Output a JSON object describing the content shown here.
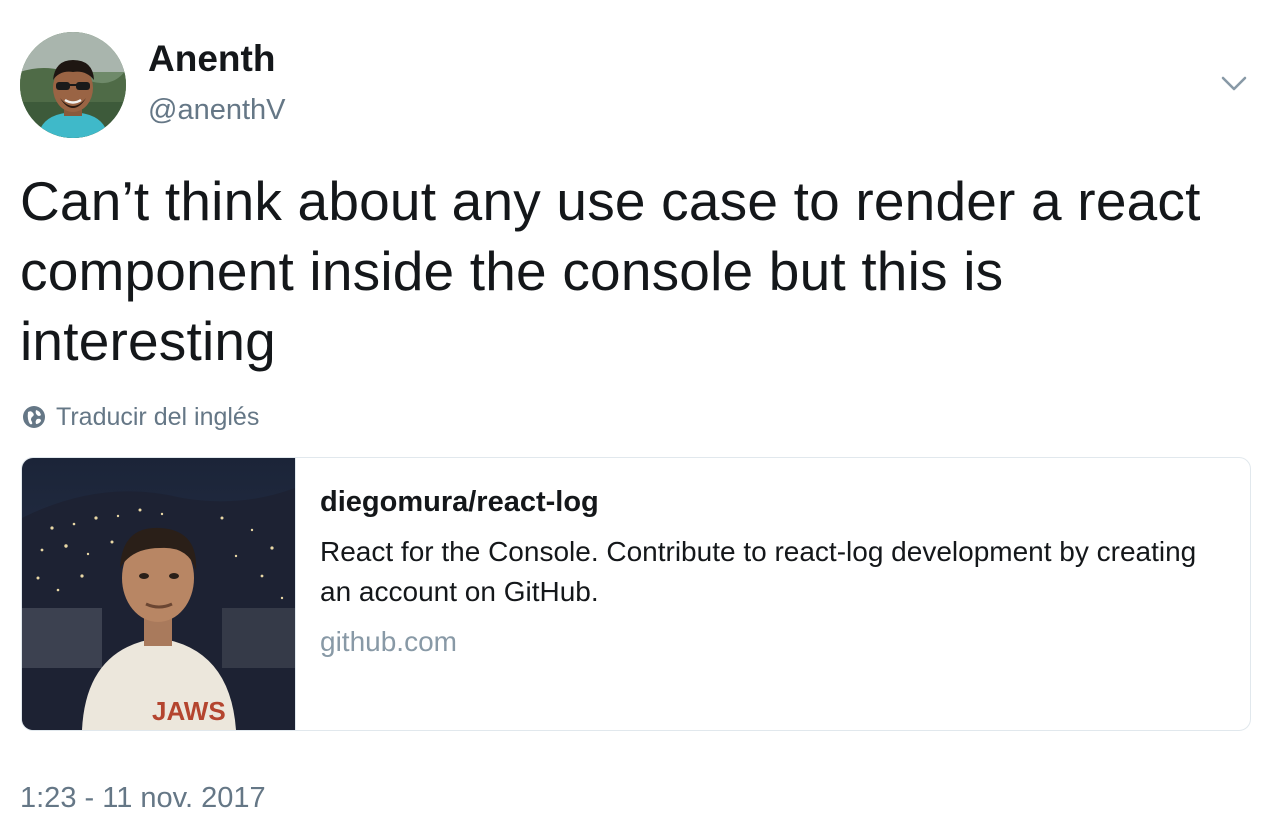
{
  "author": {
    "display_name": "Anenth",
    "handle": "@anenthV"
  },
  "tweet": {
    "text": "Can’t think about any use case to render a react component inside the console but this is interesting",
    "translate_label": "Traducir del inglés",
    "timestamp": "1:23 - 11 nov. 2017"
  },
  "card": {
    "title": "diegomura/react-log",
    "description": "React for the Console. Contribute to react-log development by creating an account on GitHub.",
    "domain": "github.com",
    "image_shirt_text": "JAWS"
  },
  "icons": {
    "caret": "chevron-down-icon",
    "translate": "globe-icon"
  },
  "colors": {
    "text_primary": "#14171a",
    "text_secondary": "#657786",
    "domain": "#8899a6",
    "card_border": "#e1e8ed"
  }
}
